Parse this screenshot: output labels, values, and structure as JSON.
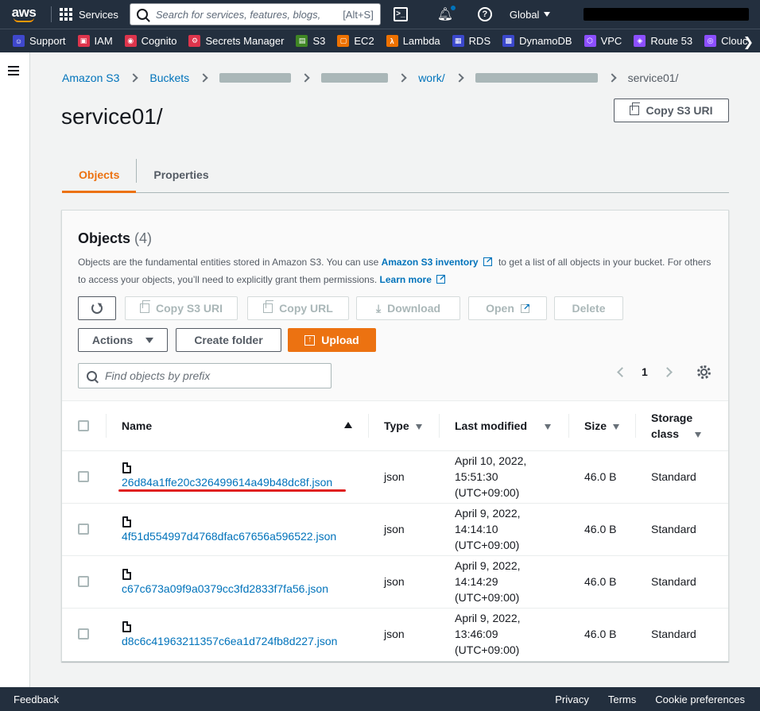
{
  "topnav": {
    "logo": "aws",
    "services_label": "Services",
    "search_placeholder": "Search for services, features, blogs, ",
    "search_hint": "[Alt+S]",
    "region": "Global"
  },
  "favorites": [
    {
      "label": "Support",
      "icon": "support-icon",
      "color": "#3f48cc"
    },
    {
      "label": "IAM",
      "icon": "iam-icon",
      "color": "#dd344c"
    },
    {
      "label": "Cognito",
      "icon": "cognito-icon",
      "color": "#dd344c"
    },
    {
      "label": "Secrets Manager",
      "icon": "secrets-manager-icon",
      "color": "#dd344c"
    },
    {
      "label": "S3",
      "icon": "s3-icon",
      "color": "#3f8624"
    },
    {
      "label": "EC2",
      "icon": "ec2-icon",
      "color": "#ed7100"
    },
    {
      "label": "Lambda",
      "icon": "lambda-icon",
      "color": "#ed7100"
    },
    {
      "label": "RDS",
      "icon": "rds-icon",
      "color": "#3b48cc"
    },
    {
      "label": "DynamoDB",
      "icon": "dynamodb-icon",
      "color": "#3b48cc"
    },
    {
      "label": "VPC",
      "icon": "vpc-icon",
      "color": "#8c4fff"
    },
    {
      "label": "Route 53",
      "icon": "route53-icon",
      "color": "#8c4fff"
    },
    {
      "label": "Clouc",
      "icon": "cloudfront-icon",
      "color": "#8c4fff"
    }
  ],
  "breadcrumb": {
    "s3": "Amazon S3",
    "buckets": "Buckets",
    "work": "work/",
    "current": "service01/"
  },
  "page": {
    "title": "service01/",
    "copy_uri": "Copy S3 URI"
  },
  "tabs": {
    "objects": "Objects",
    "properties": "Properties"
  },
  "objects_panel": {
    "title": "Objects",
    "count": "(4)",
    "desc_1": "Objects are the fundamental entities stored in Amazon S3. You can use ",
    "inventory_link": "Amazon S3 inventory",
    "desc_2": " to get a list of all objects in your bucket. For others to access your objects, you’ll need to explicitly grant them permissions. ",
    "learn_more": "Learn more",
    "buttons": {
      "copy_uri": "Copy S3 URI",
      "copy_url": "Copy URL",
      "download": "Download",
      "open": "Open",
      "delete": "Delete",
      "actions": "Actions",
      "create_folder": "Create folder",
      "upload": "Upload"
    },
    "search_placeholder": "Find objects by prefix",
    "page_number": "1",
    "columns": {
      "name": "Name",
      "type": "Type",
      "modified": "Last modified",
      "size": "Size",
      "storage_1": "Storage",
      "storage_2": "class"
    },
    "rows": [
      {
        "name": "26d84a1ffe20c326499614a49b48dc8f.json",
        "type": "json",
        "date": "April 10, 2022,",
        "time": "15:51:30",
        "tz": "(UTC+09:00)",
        "size": "46.0 B",
        "storage": "Standard"
      },
      {
        "name": "4f51d554997d4768dfac67656a596522.json",
        "type": "json",
        "date": "April 9, 2022,",
        "time": "14:14:10",
        "tz": "(UTC+09:00)",
        "size": "46.0 B",
        "storage": "Standard"
      },
      {
        "name": "c67c673a09f9a0379cc3fd2833f7fa56.json",
        "type": "json",
        "date": "April 9, 2022,",
        "time": "14:14:29",
        "tz": "(UTC+09:00)",
        "size": "46.0 B",
        "storage": "Standard"
      },
      {
        "name": "d8c6c41963211357c6ea1d724fb8d227.json",
        "type": "json",
        "date": "April 9, 2022,",
        "time": "13:46:09",
        "tz": "(UTC+09:00)",
        "size": "46.0 B",
        "storage": "Standard"
      }
    ]
  },
  "footer": {
    "feedback": "Feedback",
    "privacy": "Privacy",
    "terms": "Terms",
    "cookies": "Cookie preferences"
  },
  "colors": {
    "nav_bg": "#232f3e",
    "accent": "#ec7211",
    "link": "#0073bb",
    "highlight_underline": "#e02020"
  }
}
